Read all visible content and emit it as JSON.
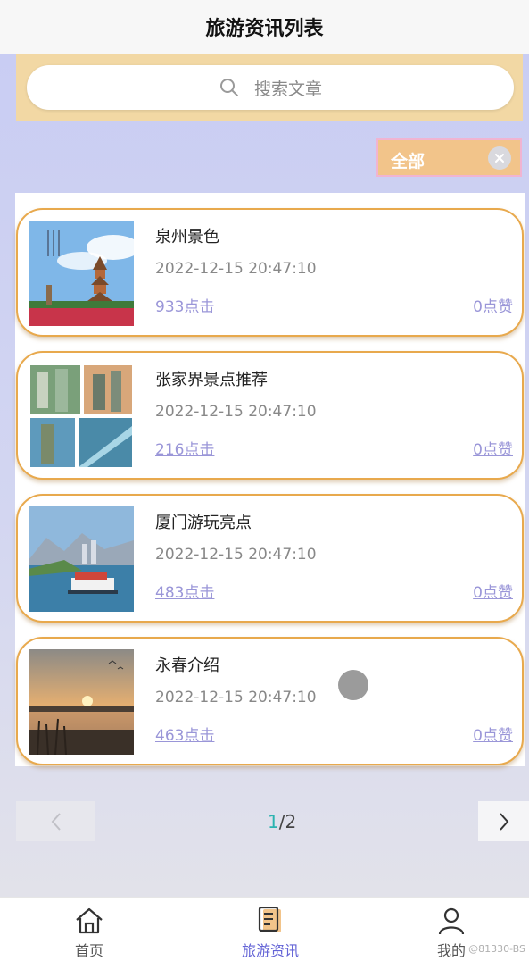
{
  "header": {
    "title": "旅游资讯列表"
  },
  "search": {
    "placeholder": "搜索文章"
  },
  "filter": {
    "label": "全部"
  },
  "articles": [
    {
      "title": "泉州景色",
      "time": "2022-12-15 20:47:10",
      "clicks": "933点击",
      "likes": "0点赞"
    },
    {
      "title": "张家界景点推荐",
      "time": "2022-12-15 20:47:10",
      "clicks": "216点击",
      "likes": "0点赞"
    },
    {
      "title": "厦门游玩亮点",
      "time": "2022-12-15 20:47:10",
      "clicks": "483点击",
      "likes": "0点赞"
    },
    {
      "title": "永春介绍",
      "time": "2022-12-15 20:47:10",
      "clicks": "463点击",
      "likes": "0点赞"
    }
  ],
  "pagination": {
    "current": "1",
    "separator": "/",
    "total": "2"
  },
  "tabs": [
    {
      "label": "首页",
      "icon": "home-icon"
    },
    {
      "label": "旅游资讯",
      "icon": "news-icon",
      "active": true
    },
    {
      "label": "我的",
      "icon": "user-icon"
    }
  ],
  "watermark": "@81330-BS",
  "colors": {
    "accent": "#6464d6",
    "card_border": "#e8a94d",
    "search_band": "#f2d8a4",
    "link": "#9a96d8",
    "page_current": "#2bb3b0"
  }
}
